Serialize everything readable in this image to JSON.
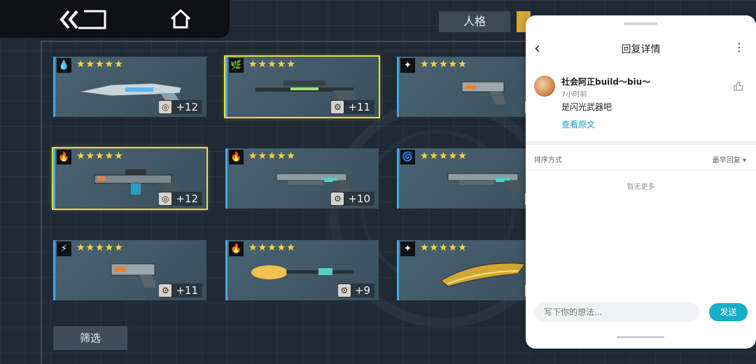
{
  "game": {
    "tabs": [
      {
        "label": "人格",
        "active": false
      },
      {
        "label": "",
        "active": true
      }
    ],
    "filter_label": "筛选",
    "cards": [
      {
        "element": "water-drop-icon",
        "element_glyph": "💧",
        "stars": "★★★★★",
        "level": "+12",
        "level_icon": "swirl-icon",
        "weapon": "rifle-icon",
        "selected": false
      },
      {
        "element": "leaf-icon",
        "element_glyph": "🌿",
        "stars": "★★★★★",
        "level": "+11",
        "level_icon": "gear-icon",
        "weapon": "sniper-icon",
        "selected": true
      },
      {
        "element": "sparkle-icon",
        "element_glyph": "✦",
        "stars": "★★★★★",
        "level": "",
        "level_icon": "gear-icon",
        "weapon": "pistol-icon",
        "selected": false
      },
      {
        "element": "fire-icon",
        "element_glyph": "🔥",
        "stars": "★★★★★",
        "level": "+12",
        "level_icon": "swirl-icon",
        "weapon": "assault-rifle-icon",
        "selected": true
      },
      {
        "element": "fire-icon",
        "element_glyph": "🔥",
        "stars": "★★★★★",
        "level": "+10",
        "level_icon": "gear-icon",
        "weapon": "shotgun-icon",
        "selected": false
      },
      {
        "element": "spiral-icon",
        "element_glyph": "🌀",
        "stars": "★★★★★",
        "level": "",
        "level_icon": "gear-icon",
        "weapon": "shotgun-icon",
        "selected": false
      },
      {
        "element": "lightning-icon",
        "element_glyph": "⚡",
        "stars": "★★★★★",
        "level": "+11",
        "level_icon": "gear-icon",
        "weapon": "pistol-icon",
        "selected": false
      },
      {
        "element": "fire-icon",
        "element_glyph": "🔥",
        "stars": "★★★★★",
        "level": "+9",
        "level_icon": "gear-icon",
        "weapon": "brush-icon",
        "selected": false
      },
      {
        "element": "sparkle-icon",
        "element_glyph": "✦",
        "stars": "★★★★★",
        "level": "",
        "level_icon": "gear-icon",
        "weapon": "blade-icon",
        "selected": false
      }
    ]
  },
  "panel": {
    "title": "回复详情",
    "more_glyph": "⋮",
    "back_glyph": "‹",
    "comment": {
      "username": "社会阿正build～biu～",
      "time": "7小时前",
      "content": "是闪光武器吧",
      "view_original": "查看原文"
    },
    "sort": {
      "label": "排序方式",
      "value": "最早回复 ▾"
    },
    "empty_text": "暂无更多",
    "input_placeholder": "写下你的想法...",
    "send_label": "发送",
    "accent_color": "#19aec8"
  }
}
